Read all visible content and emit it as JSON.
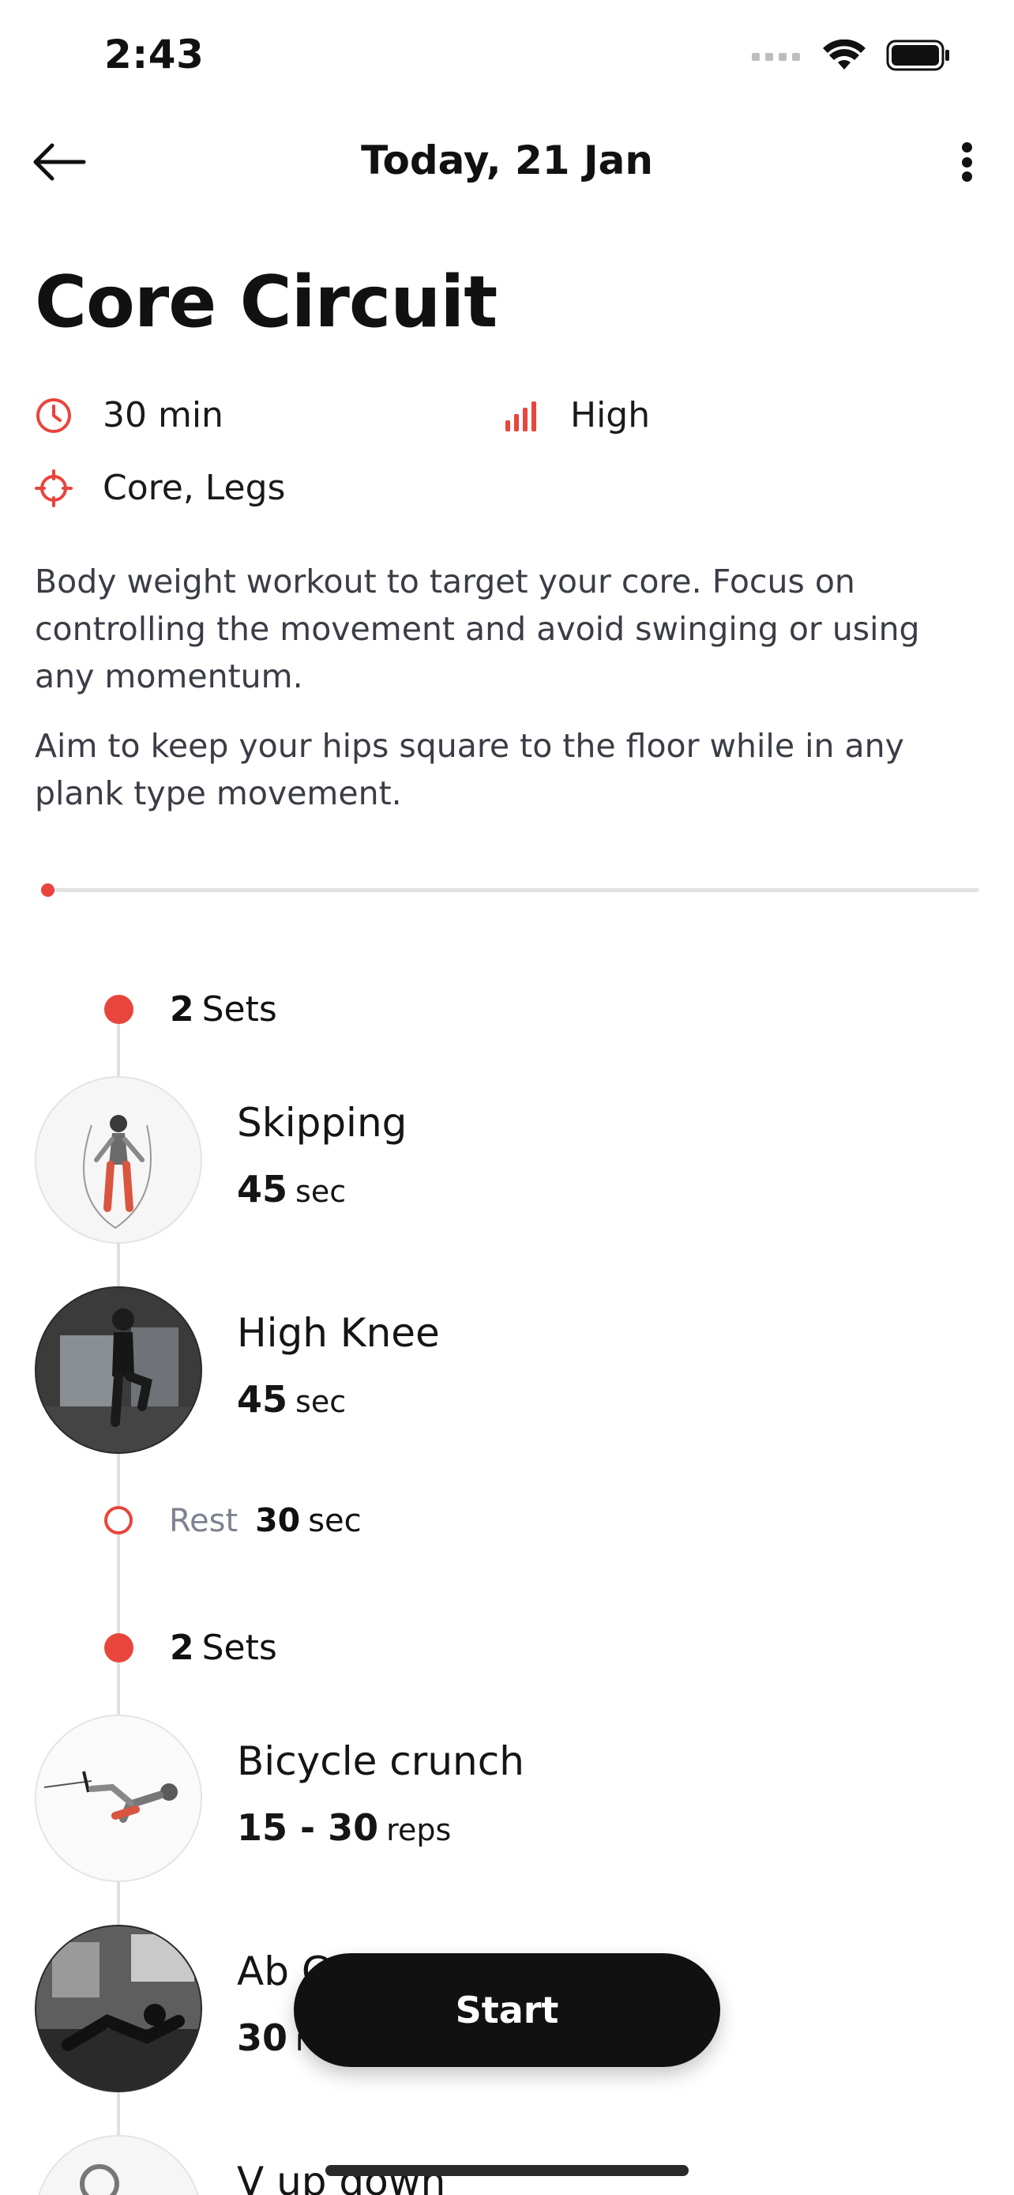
{
  "status_bar": {
    "time": "2:43"
  },
  "nav": {
    "title": "Today, 21 Jan"
  },
  "workout": {
    "title": "Core Circuit",
    "duration": "30 min",
    "intensity": "High",
    "target": "Core, Legs",
    "description": [
      "Body weight workout to target your core. Focus on controlling the movement and avoid swinging or using any momentum.",
      "Aim to keep your hips square to the floor while in any plank type movement."
    ],
    "progress_percent": 0
  },
  "colors": {
    "accent": "#e8453c",
    "button": "#111111",
    "muted": "#7d8190"
  },
  "blocks": [
    {
      "sets_count": "2",
      "sets_label": "Sets",
      "exercises": [
        {
          "name": "Skipping",
          "amount": "45",
          "unit": "sec"
        },
        {
          "name": "High Knee",
          "amount": "45",
          "unit": "sec"
        }
      ],
      "rest": {
        "label": "Rest",
        "amount": "30",
        "unit": "sec"
      }
    },
    {
      "sets_count": "2",
      "sets_label": "Sets",
      "exercises": [
        {
          "name": "Bicycle crunch",
          "amount": "15 - 30",
          "unit": "reps"
        },
        {
          "name": "Ab C",
          "amount": "30",
          "unit": "r"
        },
        {
          "name": "V up down",
          "amount": "",
          "unit": ""
        }
      ]
    }
  ],
  "actions": {
    "start_label": "Start"
  },
  "icons": [
    "back-arrow-icon",
    "more-vertical-icon",
    "clock-icon",
    "intensity-bars-icon",
    "target-crosshair-icon",
    "wifi-icon",
    "battery-icon",
    "signal-icon"
  ]
}
